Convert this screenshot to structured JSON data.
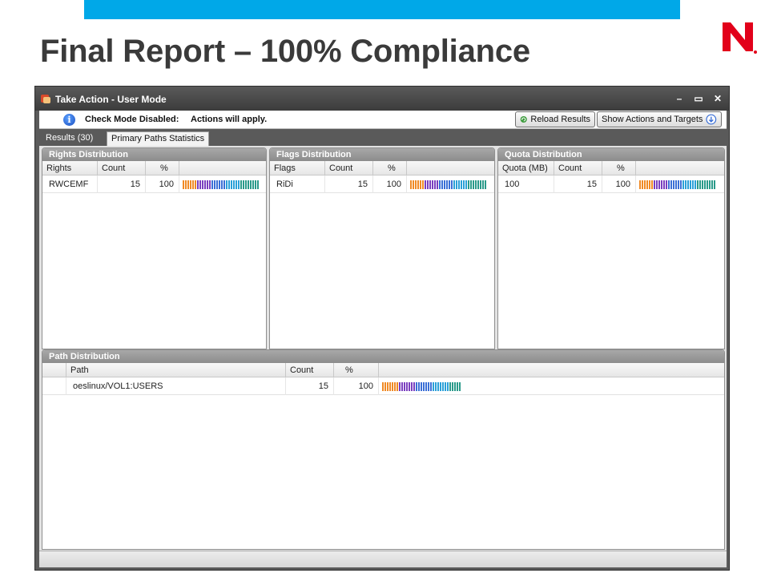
{
  "slide": {
    "title": "Final Report – 100% Compliance",
    "accent_color": "#00a8e8",
    "logo_color": "#e2001a",
    "logo_icon": "novell-n-logo"
  },
  "window": {
    "title": "Take Action - User Mode",
    "controls": [
      "minimize-icon",
      "maximize-icon",
      "close-icon"
    ]
  },
  "infobar": {
    "lead": "Check Mode Disabled:",
    "text": "Actions will apply.",
    "reload_label": "Reload Results",
    "show_label": "Show Actions and Targets"
  },
  "tabs": [
    {
      "label": "Results  (30)",
      "active": false
    },
    {
      "label": "Primary Paths Statistics",
      "active": true
    }
  ],
  "panels": {
    "rights": {
      "title": "Rights Distribution",
      "columns": [
        "Rights",
        "Count",
        "%"
      ],
      "rows": [
        {
          "key": "RWCEMF",
          "count": "15",
          "pct": "100",
          "bar_fraction": 1.0
        }
      ]
    },
    "flags": {
      "title": "Flags Distribution",
      "columns": [
        "Flags",
        "Count",
        "%"
      ],
      "rows": [
        {
          "key": "RiDi",
          "count": "15",
          "pct": "100",
          "bar_fraction": 1.0
        }
      ]
    },
    "quota": {
      "title": "Quota Distribution",
      "columns": [
        "Quota (MB)",
        "Count",
        "%"
      ],
      "rows": [
        {
          "key": "100",
          "count": "15",
          "pct": "100",
          "bar_fraction": 1.0
        }
      ]
    },
    "path": {
      "title": "Path Distribution",
      "columns": [
        "Path",
        "Count",
        "%"
      ],
      "rows": [
        {
          "key": "oeslinux/VOL1:USERS",
          "count": "15",
          "pct": "100",
          "bar_fraction": 1.0
        }
      ]
    }
  },
  "bar_colors": [
    "#f08a24",
    "#7a3fbf",
    "#3a6fd6",
    "#2aa0d8",
    "#2a9a8a"
  ]
}
